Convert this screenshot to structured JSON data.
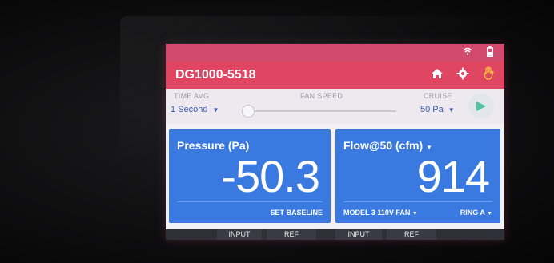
{
  "status_bar": {
    "icons": [
      "wifi-icon",
      "battery-icon"
    ]
  },
  "header": {
    "title": "DG1000-5518",
    "actions": [
      "home-icon",
      "gear-icon",
      "hand-icon"
    ],
    "warn_color": "#f3c13a"
  },
  "controls": {
    "time_avg": {
      "label": "TIME AVG",
      "value": "1 Second"
    },
    "fan_speed": {
      "label": "FAN SPEED",
      "level": 0
    },
    "cruise": {
      "label": "CRUISE",
      "value": "50 Pa"
    },
    "play_label": "▶"
  },
  "panels": [
    {
      "title": "Pressure (Pa)",
      "value": "-50.3",
      "action": "SET BASELINE"
    },
    {
      "title": "Flow@50 (cfm)",
      "value": "914",
      "fan": "MODEL 3 110V FAN",
      "ring": "RING A"
    }
  ],
  "tabs": [
    "INPUT",
    "REF",
    "INPUT",
    "REF"
  ],
  "colors": {
    "header": "#e04562",
    "statusbar": "#d24a6e",
    "panel": "#3a7ae0",
    "accent": "#52c3a3"
  }
}
